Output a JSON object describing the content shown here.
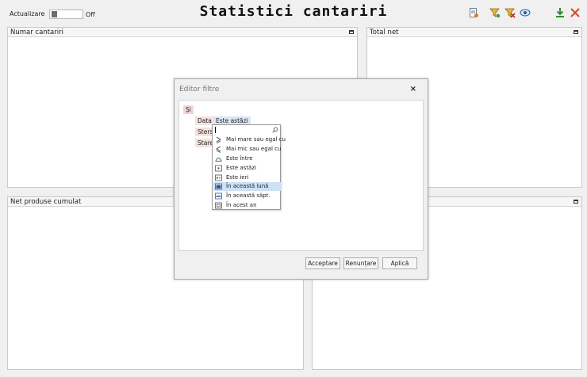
{
  "header": {
    "refresh_label": "Actualizare",
    "toggle_state": "Off",
    "title": "Statistici cantariri"
  },
  "toolbar": {
    "icons": [
      "report-icon",
      "filter-icon",
      "filter-clear-icon",
      "view-icon",
      "download-icon",
      "close-icon"
    ]
  },
  "panels": {
    "weighings_count": "Numar cantariri",
    "total_net": "Total net",
    "cumulative_net": "Net produse cumulat"
  },
  "dialog": {
    "title": "Editor filtre",
    "close": "×",
    "group_operator": "Și",
    "conditions": [
      {
        "field": "Data",
        "value": "Este astăzi"
      },
      {
        "field": "Sters"
      },
      {
        "field": "Stare"
      }
    ],
    "buttons": {
      "accept": "Acceptare",
      "cancel": "Renunțare",
      "apply": "Aplică"
    }
  },
  "dropdown": {
    "search_value": "",
    "items": [
      {
        "label": "Mai mare sau egal cu",
        "icon": "greater-equal-icon"
      },
      {
        "label": "Mai mic sau egal cu",
        "icon": "less-equal-icon"
      },
      {
        "label": "Este între",
        "icon": "between-icon"
      },
      {
        "label": "Este astăzi",
        "icon": "calendar-today-icon"
      },
      {
        "label": "Este ieri",
        "icon": "calendar-yesterday-icon"
      },
      {
        "label": "În această lună",
        "icon": "calendar-month-icon",
        "selected": true
      },
      {
        "label": "În această săpt.",
        "icon": "calendar-week-icon"
      },
      {
        "label": "În acest an",
        "icon": "calendar-year-icon"
      }
    ]
  }
}
